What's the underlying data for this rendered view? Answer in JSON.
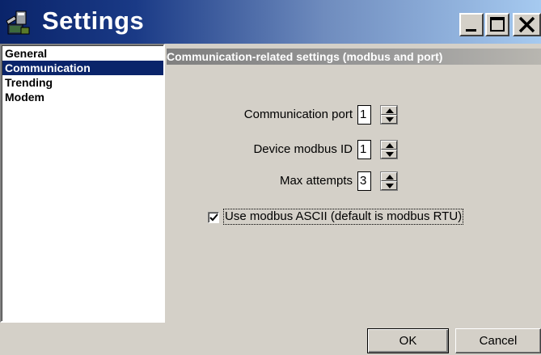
{
  "window": {
    "title": "Settings",
    "icon": "settings-app-icon",
    "controls": {
      "minimize": "minimize-icon",
      "maximize": "maximize-icon",
      "close": "close-icon"
    }
  },
  "sidebar": {
    "items": [
      {
        "label": "General",
        "selected": false
      },
      {
        "label": "Communication",
        "selected": true
      },
      {
        "label": "Trending",
        "selected": false
      },
      {
        "label": "Modem",
        "selected": false
      }
    ]
  },
  "panel": {
    "header": "Communication-related settings (modbus and port)",
    "fields": [
      {
        "label": "Communication port",
        "value": "1"
      },
      {
        "label": "Device modbus ID",
        "value": "1"
      },
      {
        "label": "Max attempts",
        "value": "3"
      }
    ],
    "checkbox": {
      "label": "Use modbus ASCII (default is modbus RTU)",
      "checked": true
    }
  },
  "buttons": {
    "ok": "OK",
    "cancel": "Cancel"
  },
  "colors": {
    "titlebar_start": "#0a246a",
    "titlebar_end": "#a6caf0",
    "selection": "#0a246a",
    "face": "#d4d0c8"
  }
}
